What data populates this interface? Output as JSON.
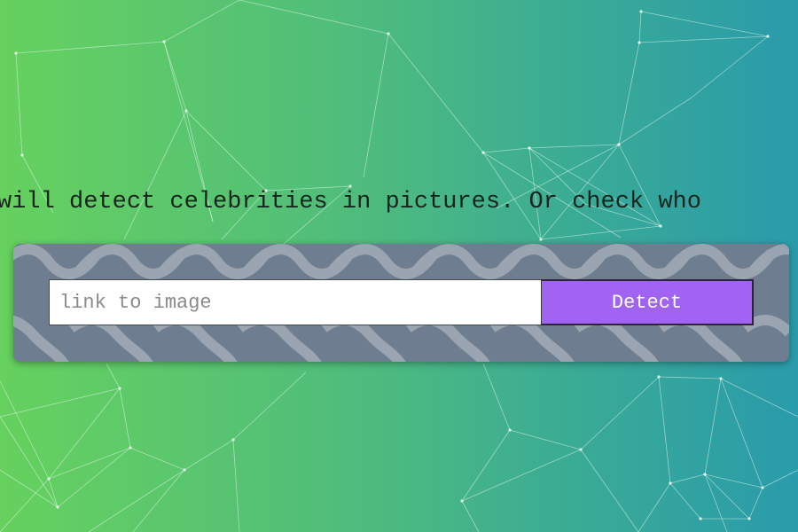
{
  "colors": {
    "background_left": "#66d15e",
    "background_right": "#2a9bab",
    "panel": "#6e7d8f",
    "button": "#a163f2",
    "network_lines": "#d8f5e6"
  },
  "hero": {
    "tagline": "will detect celebrities in pictures. Or check who"
  },
  "search": {
    "url_placeholder": "link to image",
    "url_value": "",
    "detect_label": "Detect"
  }
}
